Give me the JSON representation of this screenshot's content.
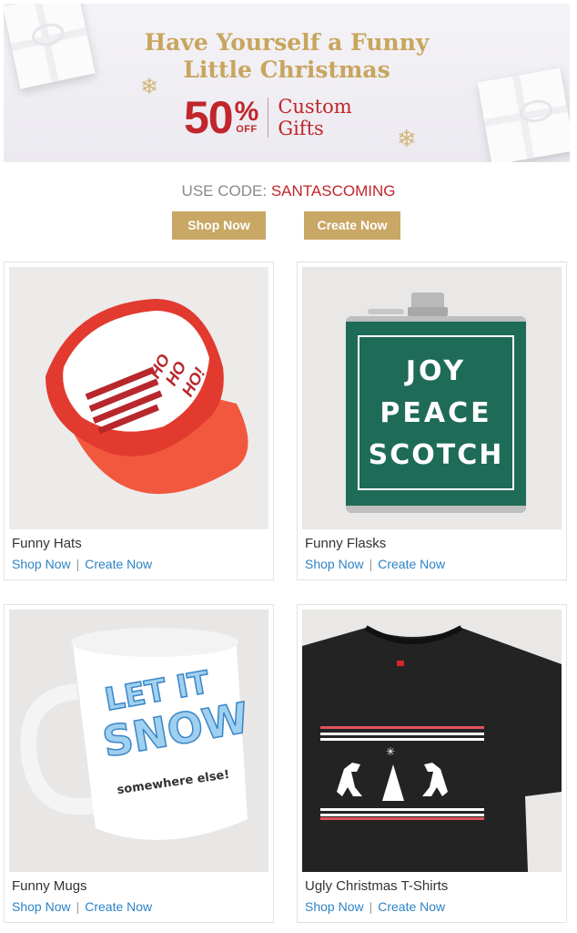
{
  "hero": {
    "headline_line1": "Have Yourself a Funny",
    "headline_line2": "Little Christmas",
    "discount_number": "50",
    "discount_symbol": "%",
    "discount_off": "OFF",
    "offer_line1": "Custom",
    "offer_line2": "Gifts"
  },
  "promo": {
    "code_label": "USE CODE:",
    "code_value": "SANTASCOMING",
    "shop_label": "Shop Now",
    "create_label": "Create Now"
  },
  "colors": {
    "gold": "#c9a764",
    "red": "#c0262b",
    "link_blue": "#2d83c5"
  },
  "products": [
    {
      "title": "Funny Hats",
      "shop": "Shop Now",
      "separator": "|",
      "create": "Create Now",
      "image_text": [
        "HO",
        "HO",
        "HO!"
      ]
    },
    {
      "title": "Funny Flasks",
      "shop": "Shop Now",
      "separator": "|",
      "create": "Create Now",
      "image_text": [
        "JOY",
        "PEACE",
        "SCOTCH"
      ]
    },
    {
      "title": "Funny Mugs",
      "shop": "Shop Now",
      "separator": "|",
      "create": "Create Now",
      "image_text": [
        "LET IT",
        "SNOW",
        "somewhere else!"
      ]
    },
    {
      "title": "Ugly Christmas T-Shirts",
      "shop": "Shop Now",
      "separator": "|",
      "create": "Create Now",
      "image_text": []
    }
  ]
}
